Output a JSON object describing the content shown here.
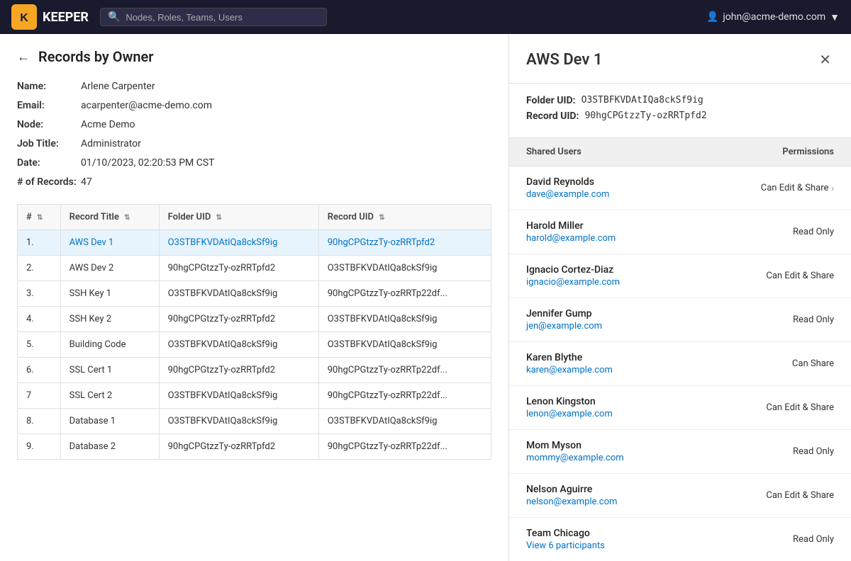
{
  "app": {
    "name": "Keeper",
    "search_placeholder": "Nodes, Roles, Teams, Users",
    "user_email": "john@acme-demo.com"
  },
  "page": {
    "title": "Records by Owner",
    "back_label": "←"
  },
  "owner": {
    "name_label": "Name:",
    "name_value": "Arlene Carpenter",
    "email_label": "Email:",
    "email_value": "acarpenter@acme-demo.com",
    "node_label": "Node:",
    "node_value": "Acme Demo",
    "job_title_label": "Job Title:",
    "job_title_value": "Administrator",
    "date_label": "Date:",
    "date_value": "01/10/2023, 02:20:53 PM CST",
    "records_label": "# of Records:",
    "records_value": "47"
  },
  "table": {
    "columns": [
      {
        "id": "num",
        "label": "#",
        "sortable": true
      },
      {
        "id": "record_title",
        "label": "Record Title",
        "sortable": true
      },
      {
        "id": "folder_uid",
        "label": "Folder UID",
        "sortable": true
      },
      {
        "id": "record_uid",
        "label": "Record UID",
        "sortable": true
      }
    ],
    "rows": [
      {
        "num": "1.",
        "record_title": "AWS Dev 1",
        "folder_uid": "O3STBFKVDAtIQa8ckSf9ig",
        "record_uid": "90hgCPGtzzTy-ozRRTpfd2",
        "selected": true,
        "link": true
      },
      {
        "num": "2.",
        "record_title": "AWS Dev 2",
        "folder_uid": "90hgCPGtzzTy-ozRRTpfd2",
        "record_uid": "O3STBFKVDAtIQa8ckSf9ig",
        "selected": false
      },
      {
        "num": "3.",
        "record_title": "SSH Key 1",
        "folder_uid": "O3STBFKVDAtIQa8ckSf9ig",
        "record_uid": "90hgCPGtzzTy-ozRRTp22df...",
        "selected": false
      },
      {
        "num": "4.",
        "record_title": "SSH Key 2",
        "folder_uid": "90hgCPGtzzTy-ozRRTpfd2",
        "record_uid": "O3STBFKVDAtIQa8ckSf9ig",
        "selected": false
      },
      {
        "num": "5.",
        "record_title": "Building Code",
        "folder_uid": "O3STBFKVDAtIQa8ckSf9ig",
        "record_uid": "O3STBFKVDAtIQa8ckSf9ig",
        "selected": false
      },
      {
        "num": "6.",
        "record_title": "SSL Cert 1",
        "folder_uid": "90hgCPGtzzTy-ozRRTpfd2",
        "record_uid": "90hgCPGtzzTy-ozRRTp22df...",
        "selected": false
      },
      {
        "num": "7",
        "record_title": "SSL Cert 2",
        "folder_uid": "O3STBFKVDAtIQa8ckSf9ig",
        "record_uid": "90hgCPGtzzTy-ozRRTp22df...",
        "selected": false
      },
      {
        "num": "8.",
        "record_title": "Database 1",
        "folder_uid": "O3STBFKVDAtIQa8ckSf9ig",
        "record_uid": "O3STBFKVDAtIQa8ckSf9ig",
        "selected": false
      },
      {
        "num": "9.",
        "record_title": "Database 2",
        "folder_uid": "90hgCPGtzzTy-ozRRTpfd2",
        "record_uid": "90hgCPGtzzTy-ozRRTp22df...",
        "selected": false
      }
    ]
  },
  "detail": {
    "title": "AWS Dev 1",
    "folder_uid_label": "Folder UID:",
    "folder_uid_value": "O3STBFKVDAtIQa8ckSf9ig",
    "record_uid_label": "Record UID:",
    "record_uid_value": "90hgCPGtzzTy-ozRRTpfd2",
    "shared_users_label": "Shared Users",
    "permissions_label": "Permissions",
    "shared_users": [
      {
        "name": "David Reynolds",
        "email": "dave@example.com",
        "permission": "Can Edit & Share",
        "has_chevron": true
      },
      {
        "name": "Harold Miller",
        "email": "harold@example.com",
        "permission": "Read Only",
        "has_chevron": false
      },
      {
        "name": "Ignacio Cortez-Diaz",
        "email": "ignacio@example.com",
        "permission": "Can Edit & Share",
        "has_chevron": false
      },
      {
        "name": "Jennifer Gump",
        "email": "jen@example.com",
        "permission": "Read Only",
        "has_chevron": false
      },
      {
        "name": "Karen Blythe",
        "email": "karen@example.com",
        "permission": "Can Share",
        "has_chevron": false
      },
      {
        "name": "Lenon Kingston",
        "email": "lenon@example.com",
        "permission": "Can Edit & Share",
        "has_chevron": false
      },
      {
        "name": "Mom Myson",
        "email": "mommy@example.com",
        "permission": "Read Only",
        "has_chevron": false
      },
      {
        "name": "Nelson Aguirre",
        "email": "nelson@example.com",
        "permission": "Can Edit & Share",
        "has_chevron": false
      },
      {
        "name": "Team Chicago",
        "email": "View 6 participants",
        "permission": "Read Only",
        "has_chevron": false
      }
    ]
  },
  "icons": {
    "back": "←",
    "close": "✕",
    "search": "🔍",
    "user": "👤",
    "sort": "⇅",
    "chevron_right": "›",
    "logo_text": "KEEPER"
  }
}
